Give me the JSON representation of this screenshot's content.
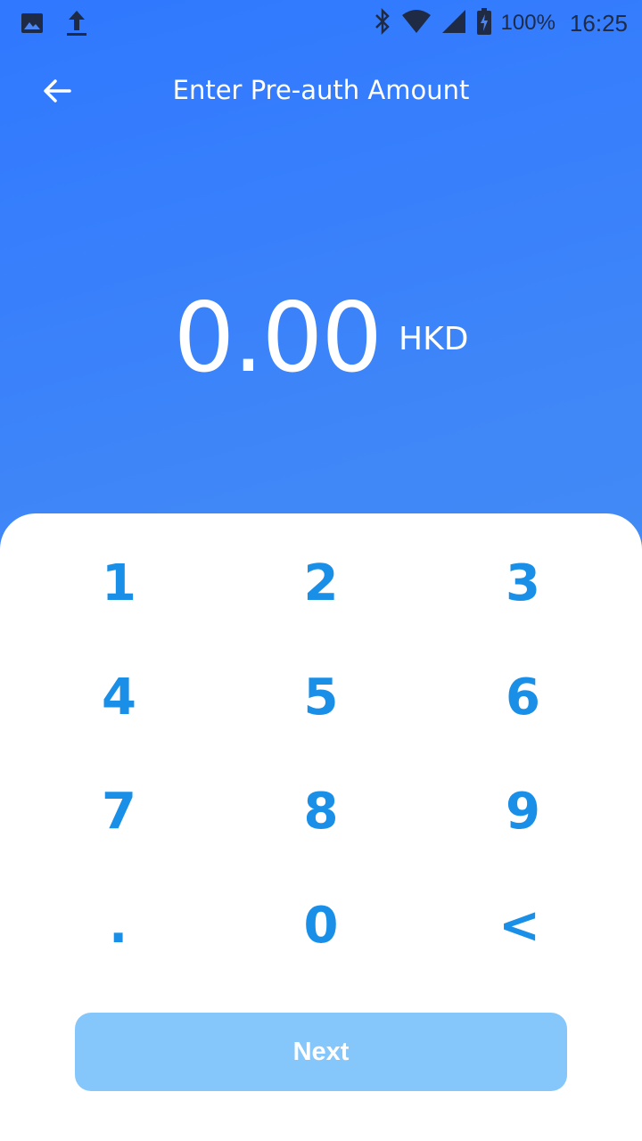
{
  "status_bar": {
    "battery_text": "100%",
    "time": "16:25",
    "icons": [
      "image-icon",
      "upload-icon",
      "bluetooth-icon",
      "wifi-icon",
      "signal-icon",
      "battery-icon"
    ]
  },
  "header": {
    "title": "Enter Pre-auth Amount",
    "back_icon": "arrow-left-icon"
  },
  "amount": {
    "value": "0.00",
    "currency": "HKD"
  },
  "keypad": {
    "keys": [
      "1",
      "2",
      "3",
      "4",
      "5",
      "6",
      "7",
      "8",
      "9",
      ".",
      "0",
      "<"
    ]
  },
  "next_button": {
    "label": "Next"
  },
  "colors": {
    "gradient_top": "#2f78ff",
    "gradient_bottom": "#4a97ee",
    "key_color": "#1a8fe8",
    "next_button_bg": "#86c7fb"
  }
}
